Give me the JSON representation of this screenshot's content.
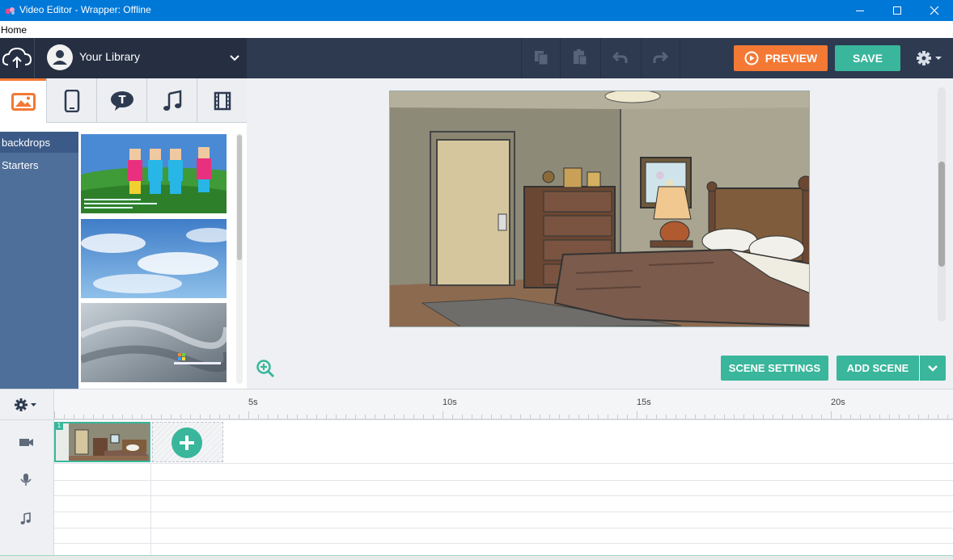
{
  "window": {
    "title": "Video Editor - Wrapper: Offline",
    "controls": [
      "minimize-icon",
      "maximize-icon",
      "close-icon"
    ]
  },
  "menu": {
    "items": [
      "Home"
    ]
  },
  "library": {
    "label": "Your Library",
    "user_icon": "user-icon",
    "chevron": "chevron-down-icon"
  },
  "toolbar": {
    "icons": [
      "copy-icon",
      "paste-icon",
      "undo-icon",
      "redo-icon"
    ],
    "preview_label": "PREVIEW",
    "save_label": "SAVE",
    "settings_icon": "gear-icon"
  },
  "asset_tabs": [
    "image-icon",
    "phone-icon",
    "speech-bubble-icon",
    "music-note-icon",
    "film-icon"
  ],
  "asset_categories": [
    {
      "label": "backdrops",
      "active": true
    },
    {
      "label": "Starters",
      "active": false
    }
  ],
  "stage": {
    "scene_settings_label": "SCENE SETTINGS",
    "add_scene_label": "ADD SCENE",
    "zoom_icon": "zoom-in-icon"
  },
  "timeline": {
    "ruler_labels": [
      "5s",
      "10s",
      "15s",
      "20s"
    ],
    "tracks": [
      "video-camera-icon",
      "microphone-icon",
      "music-note-icon"
    ],
    "scenes": [
      {
        "number": "1"
      }
    ]
  },
  "colors": {
    "accent_orange": "#f37935",
    "accent_teal": "#39b69b",
    "sidebar_blue": "#4e6f9a",
    "toolbar_navy": "#2d3a50"
  }
}
